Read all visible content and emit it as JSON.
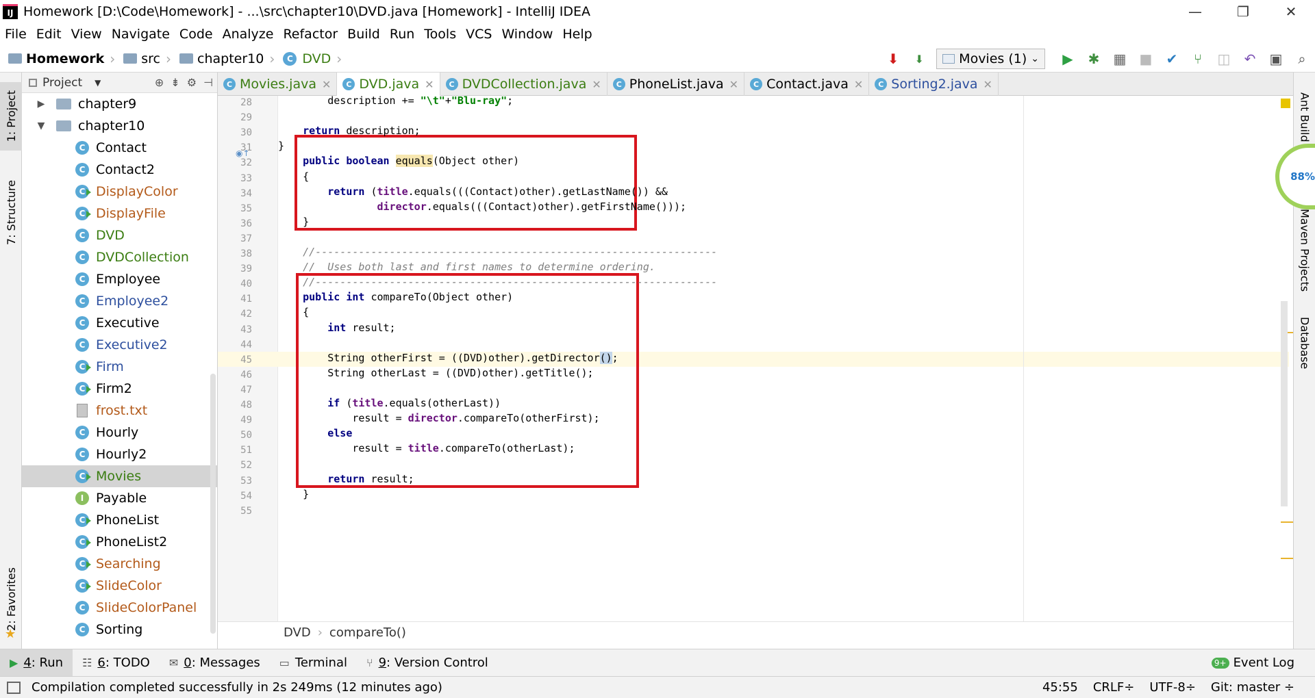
{
  "window": {
    "title": "Homework [D:\\Code\\Homework] - ...\\src\\chapter10\\DVD.java [Homework] - IntelliJ IDEA",
    "logo": "IJ"
  },
  "menu": [
    "File",
    "Edit",
    "View",
    "Navigate",
    "Code",
    "Analyze",
    "Refactor",
    "Build",
    "Run",
    "Tools",
    "VCS",
    "Window",
    "Help"
  ],
  "breadcrumbs": [
    "Homework",
    "src",
    "chapter10",
    "DVD"
  ],
  "run_config": "Movies (1)",
  "left_tabs": {
    "project": "1: Project",
    "structure": "7: Structure",
    "favorites": "2: Favorites"
  },
  "right_tabs": {
    "ant": "Ant Build",
    "maven": "Maven Projects",
    "database": "Database"
  },
  "project_panel": {
    "title": "Project",
    "tree": [
      {
        "label": "chapter9",
        "kind": "folder",
        "arrow": "▶"
      },
      {
        "label": "chapter10",
        "kind": "folder",
        "arrow": "▼"
      },
      {
        "label": "Contact",
        "kind": "class",
        "color": "black"
      },
      {
        "label": "Contact2",
        "kind": "class",
        "color": "black"
      },
      {
        "label": "DisplayColor",
        "kind": "run",
        "color": "orange"
      },
      {
        "label": "DisplayFile",
        "kind": "run",
        "color": "orange"
      },
      {
        "label": "DVD",
        "kind": "class",
        "color": "green"
      },
      {
        "label": "DVDCollection",
        "kind": "class",
        "color": "green"
      },
      {
        "label": "Employee",
        "kind": "class",
        "color": "black"
      },
      {
        "label": "Employee2",
        "kind": "class",
        "color": "blue"
      },
      {
        "label": "Executive",
        "kind": "class",
        "color": "black"
      },
      {
        "label": "Executive2",
        "kind": "class",
        "color": "blue"
      },
      {
        "label": "Firm",
        "kind": "run",
        "color": "blue"
      },
      {
        "label": "Firm2",
        "kind": "run",
        "color": "black"
      },
      {
        "label": "frost.txt",
        "kind": "file",
        "color": "orange"
      },
      {
        "label": "Hourly",
        "kind": "class",
        "color": "black"
      },
      {
        "label": "Hourly2",
        "kind": "class",
        "color": "black"
      },
      {
        "label": "Movies",
        "kind": "run",
        "color": "green",
        "selected": true
      },
      {
        "label": "Payable",
        "kind": "iface",
        "color": "black"
      },
      {
        "label": "PhoneList",
        "kind": "run",
        "color": "black"
      },
      {
        "label": "PhoneList2",
        "kind": "run",
        "color": "black"
      },
      {
        "label": "Searching",
        "kind": "run",
        "color": "orange"
      },
      {
        "label": "SlideColor",
        "kind": "run",
        "color": "orange"
      },
      {
        "label": "SlideColorPanel",
        "kind": "class",
        "color": "orange"
      },
      {
        "label": "Sorting",
        "kind": "class",
        "color": "black"
      }
    ]
  },
  "tabs": [
    {
      "label": "Movies.java",
      "color": "green",
      "active": false
    },
    {
      "label": "DVD.java",
      "color": "green",
      "active": true
    },
    {
      "label": "DVDCollection.java",
      "color": "green",
      "active": false
    },
    {
      "label": "PhoneList.java",
      "color": "black",
      "active": false
    },
    {
      "label": "Contact.java",
      "color": "black",
      "active": false
    },
    {
      "label": "Sorting2.java",
      "color": "blue",
      "active": false
    }
  ],
  "code": {
    "line_numbers": [
      28,
      29,
      30,
      31,
      32,
      33,
      34,
      35,
      36,
      37,
      38,
      39,
      40,
      41,
      42,
      43,
      44,
      45,
      46,
      47,
      48,
      49,
      50,
      51,
      52,
      53,
      54,
      55
    ],
    "caret_line": 45,
    "lines": [
      [
        [
          "        description += ",
          ""
        ],
        [
          "\"\\t\"",
          "str"
        ],
        [
          "+",
          ""
        ],
        [
          "\"Blu-ray\"",
          "str"
        ],
        [
          ";",
          ""
        ]
      ],
      [],
      [
        [
          "    ",
          ""
        ],
        [
          "return",
          "kw"
        ],
        [
          " description;",
          ""
        ]
      ],
      [
        [
          "}",
          ""
        ]
      ],
      [
        [
          "    ",
          ""
        ],
        [
          "public boolean",
          "kw"
        ],
        [
          " ",
          ""
        ],
        [
          "equals",
          "hl"
        ],
        [
          "(Object other)",
          ""
        ]
      ],
      [
        [
          "    {",
          ""
        ]
      ],
      [
        [
          "        ",
          ""
        ],
        [
          "return",
          "kw"
        ],
        [
          " (",
          ""
        ],
        [
          "title",
          "fld"
        ],
        [
          ".equals(((Contact)other).getLastName()) &&",
          ""
        ]
      ],
      [
        [
          "                ",
          ""
        ],
        [
          "director",
          "fld"
        ],
        [
          ".equals(((Contact)other).getFirstName()));",
          ""
        ]
      ],
      [
        [
          "    }",
          ""
        ]
      ],
      [],
      [
        [
          "    //-----------------------------------------------------------------",
          "cmt"
        ]
      ],
      [
        [
          "    //  Uses both last and first names to determine ordering.",
          "cmt"
        ]
      ],
      [
        [
          "    //-----------------------------------------------------------------",
          "cmt"
        ]
      ],
      [
        [
          "    ",
          ""
        ],
        [
          "public int",
          "kw"
        ],
        [
          " compareTo(Object other)",
          ""
        ]
      ],
      [
        [
          "    {",
          ""
        ]
      ],
      [
        [
          "        ",
          ""
        ],
        [
          "int",
          "kw"
        ],
        [
          " result;",
          ""
        ]
      ],
      [],
      [
        [
          "        String otherFirst = ((DVD)other).getDirector",
          ""
        ],
        [
          "()",
          "hlb"
        ],
        [
          ";",
          ""
        ]
      ],
      [
        [
          "        String otherLast = ((DVD)other).getTitle();",
          ""
        ]
      ],
      [],
      [
        [
          "        ",
          ""
        ],
        [
          "if",
          "kw"
        ],
        [
          " (",
          ""
        ],
        [
          "title",
          "fld"
        ],
        [
          ".equals(otherLast))",
          ""
        ]
      ],
      [
        [
          "            result = ",
          ""
        ],
        [
          "director",
          "fld"
        ],
        [
          ".compareTo(otherFirst);",
          ""
        ]
      ],
      [
        [
          "        ",
          ""
        ],
        [
          "else",
          "kw"
        ]
      ],
      [
        [
          "            result = ",
          ""
        ],
        [
          "title",
          "fld"
        ],
        [
          ".compareTo(otherLast);",
          ""
        ]
      ],
      [],
      [
        [
          "        ",
          ""
        ],
        [
          "return",
          "kw"
        ],
        [
          " result;",
          ""
        ]
      ],
      [
        [
          "    }",
          ""
        ]
      ],
      []
    ]
  },
  "editor_breadcrumb": [
    "DVD",
    "compareTo()"
  ],
  "memory_gauge": "88%",
  "bottom_tools": [
    {
      "num": "4",
      "label": ": Run",
      "icon": "▶",
      "active": true
    },
    {
      "num": "6",
      "label": ": TODO",
      "icon": "☷",
      "active": false
    },
    {
      "num": "0",
      "label": ": Messages",
      "icon": "✉",
      "active": false
    },
    {
      "num": "",
      "label": "Terminal",
      "icon": "▭",
      "active": false
    },
    {
      "num": "9",
      "label": ": Version Control",
      "icon": "⑂",
      "active": false
    }
  ],
  "event_log": {
    "badge": "9+",
    "label": "Event Log"
  },
  "status": {
    "message": "Compilation completed successfully in 2s 249ms (12 minutes ago)",
    "position": "45:55",
    "line_sep": "CRLF÷",
    "encoding": "UTF-8÷",
    "git": "Git: master ÷"
  }
}
